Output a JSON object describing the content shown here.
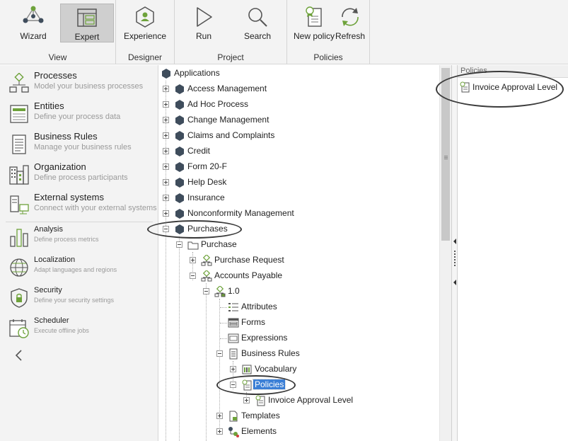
{
  "ribbon": {
    "groups": [
      {
        "label": "View",
        "buttons": [
          {
            "label": "Wizard"
          },
          {
            "label": "Expert"
          }
        ]
      },
      {
        "label": "Designer",
        "buttons": [
          {
            "label": "Experience"
          }
        ]
      },
      {
        "label": "Project",
        "buttons": [
          {
            "label": "Run"
          },
          {
            "label": "Search"
          }
        ]
      },
      {
        "label": "Policies",
        "buttons": [
          {
            "label": "New policy"
          },
          {
            "label": "Refresh"
          }
        ]
      }
    ],
    "active_button": "Expert"
  },
  "nav": {
    "items": [
      {
        "title": "Processes",
        "subtitle": "Model your business processes"
      },
      {
        "title": "Entities",
        "subtitle": "Define your process data"
      },
      {
        "title": "Business Rules",
        "subtitle": "Manage your business rules"
      },
      {
        "title": "Organization",
        "subtitle": "Define process participants"
      },
      {
        "title": "External systems",
        "subtitle": "Connect with your external systems"
      },
      {
        "title": "Analysis",
        "subtitle": "Define process metrics"
      },
      {
        "title": "Localization",
        "subtitle": "Adapt languages and regions"
      },
      {
        "title": "Security",
        "subtitle": "Define your security settings"
      },
      {
        "title": "Scheduler",
        "subtitle": "Execute offline jobs"
      }
    ],
    "collapse_icon": "chevron-left-icon"
  },
  "tree": {
    "root": "Applications",
    "apps": [
      "Access Management",
      "Ad Hoc Process",
      "Change Management",
      "Claims and Complaints",
      "Credit",
      "Form 20-F",
      "Help Desk",
      "Insurance",
      "Nonconformity Management",
      "Purchases"
    ],
    "purchases": {
      "child": "Purchase",
      "processes": [
        "Purchase Request",
        "Accounts Payable"
      ],
      "version": "1.0",
      "version_items": [
        "Attributes",
        "Forms",
        "Expressions",
        "Business Rules"
      ],
      "business_rules_children": [
        "Vocabulary",
        "Policies"
      ],
      "policies_children": [
        "Invoice Approval Level"
      ],
      "after": [
        "Templates",
        "Elements"
      ]
    },
    "selected": "Policies"
  },
  "policies_panel": {
    "header": "Policies",
    "items": [
      "Invoice Approval Level"
    ]
  },
  "colors": {
    "accent": "#3b7fd6",
    "app_hexagon": "#3f4d5c",
    "process_green": "#6ea23b",
    "ribbon_bg": "#f3f3f3"
  }
}
